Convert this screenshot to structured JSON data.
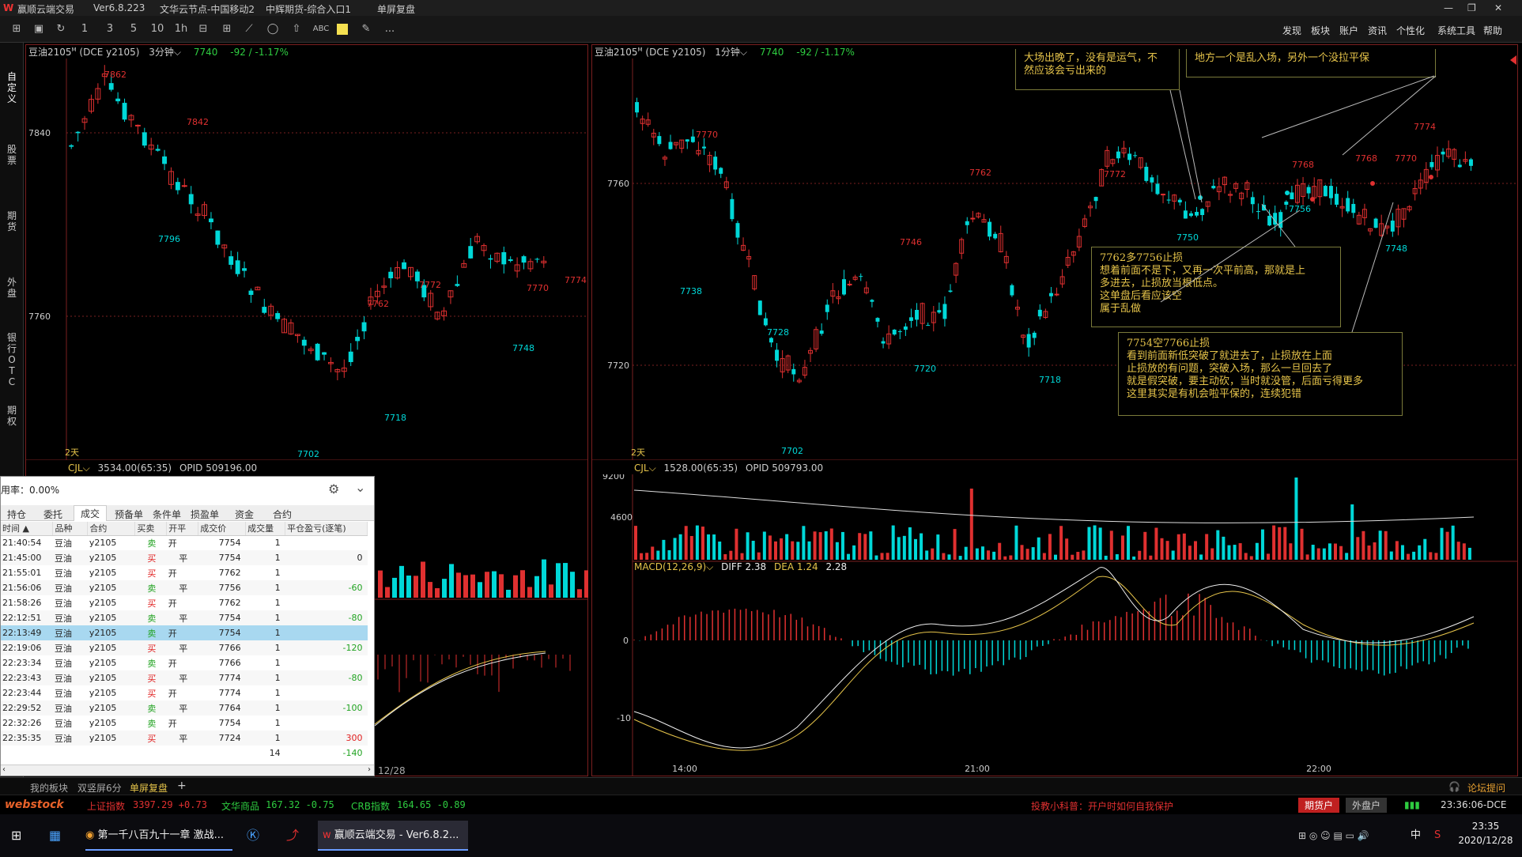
{
  "titlebar": {
    "app": "赢顺云端交易",
    "version": "Ver6.8.223",
    "node": "文华云节点-中国移动2",
    "broker": "中辉期货-综合入口1",
    "mode": "单屏复盘"
  },
  "menu": [
    "发现",
    "板块",
    "账户",
    "资讯",
    "个性化",
    "系统工具",
    "帮助"
  ],
  "toolbar_icons": [
    "layout-icon",
    "save-icon",
    "refresh-icon",
    "period-1-icon",
    "period-3-icon",
    "period-5-icon",
    "period-10-icon",
    "period-1h-icon",
    "split-icon",
    "grid-icon",
    "line-icon",
    "ellipse-icon",
    "arrow-icon",
    "text-icon",
    "color-icon",
    "pen-icon",
    "more-icon"
  ],
  "toolbar_text": {
    "period_1": "1",
    "period_3": "3",
    "period_5": "5",
    "period_10": "10",
    "period_1h": "1h",
    "text_tool": "ABC",
    "more": "..."
  },
  "leftbar": [
    "自定义",
    "股票",
    "期货",
    "外盘",
    "银行OTC",
    "期权"
  ],
  "left_chart": {
    "symbol": "豆油2105",
    "sup": "M",
    "exch": "(DCE y2105)",
    "period": "3分钟",
    "price": "7740",
    "change": "-92 / -1.17%",
    "yticks": [
      "7840",
      "7760"
    ],
    "labels_hi": [
      "7862",
      "7842",
      "7762",
      "7772",
      "7770",
      "7774"
    ],
    "labels_lo": [
      "7796",
      "7718",
      "7702",
      "7748"
    ],
    "days": "2天",
    "cjl": "3534.00(65:35)",
    "opid": "OPID 509196.00",
    "date": "12/28"
  },
  "right_chart": {
    "symbol": "豆油2105",
    "sup": "M",
    "exch": "(DCE y2105)",
    "period": "1分钟",
    "price": "7740",
    "change": "-92 / -1.17%",
    "yticks": [
      "7760",
      "7720"
    ],
    "labels_hi": [
      "7770",
      "7746",
      "7762",
      "7772",
      "7768",
      "7768",
      "7770",
      "7774"
    ],
    "labels_lo": [
      "7738",
      "7728",
      "7720",
      "7718",
      "7702",
      "7750",
      "7756",
      "7748"
    ],
    "days": "2天",
    "cjl": "1528.00(65:35)",
    "opid": "OPID 509793.00",
    "vol_ticks": [
      "9200",
      "4600"
    ],
    "macd": "MACD(12,26,9)",
    "diff": "DIFF 2.38",
    "dea": "DEA 1.24",
    "macd_val": "2.28",
    "macd_ticks": [
      "0",
      "-10"
    ],
    "xlabels": [
      "14:00",
      "21:00",
      "22:00"
    ]
  },
  "annotations": {
    "a1": [
      "大场出晚了，没有是运气，不",
      "然应该会亏出来的"
    ],
    "a2": [
      "地方一个是乱入场，另外一个没拉平保"
    ],
    "a3": [
      "7762多7756止损",
      "想着前面不是下，又再一次平前高，那就是上",
      "多进去，止损放当根低点。",
      "这单盘后看应该空",
      "属于乱做"
    ],
    "a4": [
      "7754空7766止损",
      "看到前面新低突破了就进去了，止损放在上面",
      "止损放的有问题，突破入场，那么一旦回去了",
      "就是假突破，要主动砍，当时就没管，后面亏得更多",
      "这里其实是有机会啦平保的，连续犯错"
    ]
  },
  "dialog": {
    "usage": "用率：0.00%",
    "tabs": [
      "持仓",
      "委托",
      "成交",
      "预备单",
      "条件单",
      "损盈单",
      "资金",
      "合约"
    ],
    "active_tab": "成交",
    "cols": [
      "时间 ▲",
      "品种",
      "合约",
      "买卖",
      "开平",
      "成交价",
      "成交量",
      "平仓盈亏(逐笔)"
    ],
    "rows": [
      [
        "21:40:54",
        "豆油",
        "y2105",
        "卖",
        "开",
        "7754",
        "1",
        ""
      ],
      [
        "21:45:00",
        "豆油",
        "y2105",
        "买",
        "平",
        "7754",
        "1",
        "0"
      ],
      [
        "21:55:01",
        "豆油",
        "y2105",
        "买",
        "开",
        "7762",
        "1",
        ""
      ],
      [
        "21:56:06",
        "豆油",
        "y2105",
        "卖",
        "平",
        "7756",
        "1",
        "-60"
      ],
      [
        "21:58:26",
        "豆油",
        "y2105",
        "买",
        "开",
        "7762",
        "1",
        ""
      ],
      [
        "22:12:51",
        "豆油",
        "y2105",
        "卖",
        "平",
        "7754",
        "1",
        "-80"
      ],
      [
        "22:13:49",
        "豆油",
        "y2105",
        "卖",
        "开",
        "7754",
        "1",
        ""
      ],
      [
        "22:19:06",
        "豆油",
        "y2105",
        "买",
        "平",
        "7766",
        "1",
        "-120"
      ],
      [
        "22:23:34",
        "豆油",
        "y2105",
        "卖",
        "开",
        "7766",
        "1",
        ""
      ],
      [
        "22:23:43",
        "豆油",
        "y2105",
        "买",
        "平",
        "7774",
        "1",
        "-80"
      ],
      [
        "22:23:44",
        "豆油",
        "y2105",
        "买",
        "开",
        "7774",
        "1",
        ""
      ],
      [
        "22:29:52",
        "豆油",
        "y2105",
        "卖",
        "平",
        "7764",
        "1",
        "-100"
      ],
      [
        "22:32:26",
        "豆油",
        "y2105",
        "卖",
        "开",
        "7754",
        "1",
        ""
      ],
      [
        "22:35:35",
        "豆油",
        "y2105",
        "买",
        "平",
        "7724",
        "1",
        "300"
      ]
    ],
    "total_qty": "14",
    "total_pnl": "-140"
  },
  "bottom_tabs": [
    "我的板块",
    "双竖屏6分",
    "单屏复盘",
    "+"
  ],
  "forum": "论坛提问",
  "status": {
    "logo": "webstock",
    "idx1_name": "上证指数",
    "idx1": "3397.29 +0.73",
    "idx2_name": "文华商品",
    "idx2": "167.32 -0.75",
    "idx3_name": "CRB指数",
    "idx3": "164.65 -0.89",
    "tip": "投教小科普：开户时如何自我保护",
    "btn1": "期货户",
    "btn2": "外盘户",
    "clock": "23:36:06-DCE"
  },
  "taskbar": {
    "task1": "第一千八百九十一章 激战...",
    "task2": "赢顺云端交易 - Ver6.8.2...",
    "time": "23:35",
    "date": "2020/12/28",
    "ime": "中"
  },
  "colors": {
    "up": "#e03030",
    "down": "#00d8d8",
    "frame": "#7a1f1f",
    "ann": "#e6c44a"
  }
}
